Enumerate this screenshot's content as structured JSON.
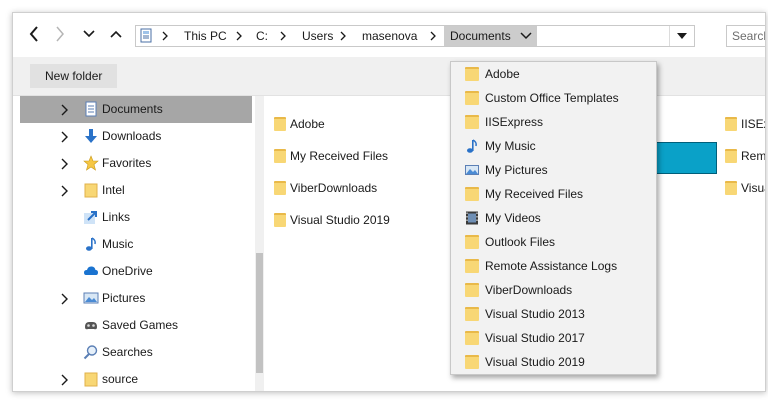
{
  "nav": {
    "back": "back",
    "forward": "forward",
    "recent": "recent",
    "up": "up"
  },
  "address": {
    "crumbs": [
      "This PC",
      "C:",
      "Users",
      "masenova",
      "Documents"
    ],
    "icon": "computer-icon"
  },
  "search": {
    "placeholder": "Search"
  },
  "toolbar": {
    "new_folder_label": "New folder"
  },
  "sidebar": {
    "items": [
      {
        "label": "Documents",
        "icon": "documents-icon",
        "expandable": true,
        "selected": true
      },
      {
        "label": "Downloads",
        "icon": "downloads-icon",
        "expandable": true
      },
      {
        "label": "Favorites",
        "icon": "star-icon",
        "expandable": true
      },
      {
        "label": "Intel",
        "icon": "folder-icon",
        "expandable": true
      },
      {
        "label": "Links",
        "icon": "links-icon",
        "expandable": false
      },
      {
        "label": "Music",
        "icon": "music-icon",
        "expandable": false
      },
      {
        "label": "OneDrive",
        "icon": "cloud-icon",
        "expandable": false
      },
      {
        "label": "Pictures",
        "icon": "pictures-icon",
        "expandable": true
      },
      {
        "label": "Saved Games",
        "icon": "saved-games-icon",
        "expandable": false
      },
      {
        "label": "Searches",
        "icon": "search-icon",
        "expandable": false
      },
      {
        "label": "source",
        "icon": "folder-icon",
        "expandable": true
      }
    ]
  },
  "content": {
    "left_column": [
      "Adobe",
      "My Received Files",
      "ViberDownloads",
      "Visual Studio 2019"
    ],
    "right_column": [
      "IISExpr",
      "Remot",
      "Visual"
    ]
  },
  "dropdown": {
    "items": [
      {
        "label": "Adobe",
        "icon": "folder-icon"
      },
      {
        "label": "Custom Office Templates",
        "icon": "folder-icon"
      },
      {
        "label": "IISExpress",
        "icon": "folder-icon"
      },
      {
        "label": "My Music",
        "icon": "music-icon"
      },
      {
        "label": "My Pictures",
        "icon": "pictures-icon"
      },
      {
        "label": "My Received Files",
        "icon": "folder-icon"
      },
      {
        "label": "My Videos",
        "icon": "videos-icon"
      },
      {
        "label": "Outlook Files",
        "icon": "folder-icon"
      },
      {
        "label": "Remote Assistance Logs",
        "icon": "folder-icon"
      },
      {
        "label": "ViberDownloads",
        "icon": "folder-icon"
      },
      {
        "label": "Visual Studio 2013",
        "icon": "folder-icon"
      },
      {
        "label": "Visual Studio 2017",
        "icon": "folder-icon"
      },
      {
        "label": "Visual Studio 2019",
        "icon": "folder-icon"
      }
    ]
  },
  "colors": {
    "folder": "#f8d775",
    "selected_bg": "#a6a6a6",
    "highlight_tile": "#0aa1c8"
  }
}
